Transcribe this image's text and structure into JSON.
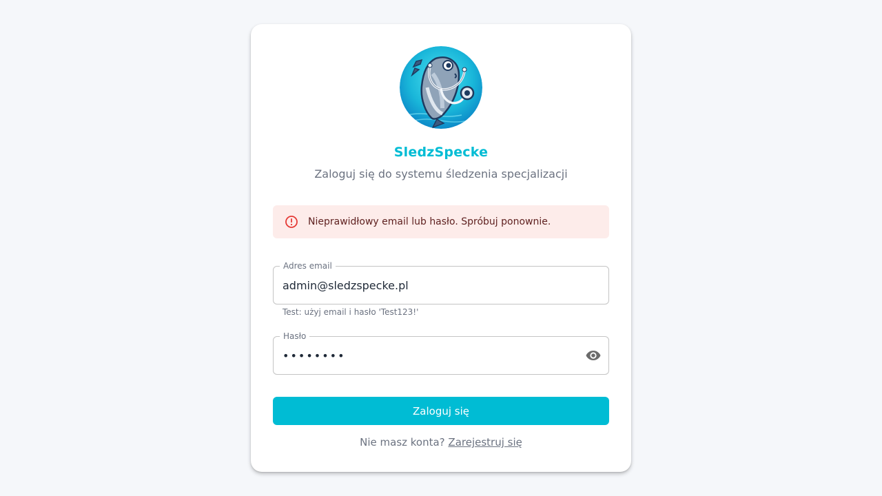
{
  "app": {
    "title": "SledzSpecke",
    "subtitle": "Zaloguj się do systemu śledzenia specjalizacji",
    "logo_icon": "fish-stethoscope-logo"
  },
  "alert": {
    "icon": "error-circle-icon",
    "message": "Nieprawidłowy email lub hasło. Spróbuj ponownie."
  },
  "form": {
    "email_label": "Adres email",
    "email_value": "admin@sledzspecke.pl",
    "email_helper": "Test: użyj email i hasło 'Test123!'",
    "password_label": "Hasło",
    "password_value": "••••••••",
    "password_toggle_icon": "eye-icon",
    "submit_label": "Zaloguj się"
  },
  "footer": {
    "prompt": "Nie masz konta?",
    "register_link": "Zarejestruj się"
  },
  "colors": {
    "accent": "#00bcd4",
    "alert_bg": "#fdecea",
    "alert_icon": "#e53935",
    "page_bg": "#f5f7fa"
  }
}
